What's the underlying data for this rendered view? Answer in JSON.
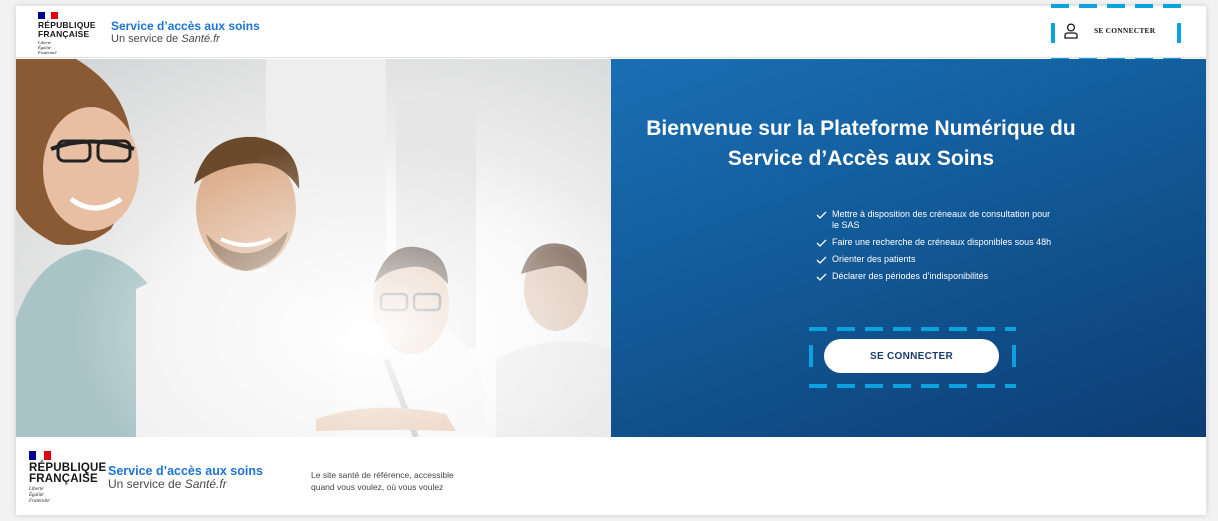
{
  "header": {
    "republique_line1": "RÉPUBLIQUE",
    "republique_line2": "FRANÇAISE",
    "motto": [
      "Liberté",
      "Égalité",
      "Fraternité"
    ],
    "site_title": "Service d’accès aux soins",
    "site_subtitle_prefix": "Un service de ",
    "site_subtitle_brand": "Santé.fr",
    "login_label": "SE CONNECTER",
    "login_icon": "user-icon"
  },
  "hero": {
    "title": "Bienvenue sur la Plateforme Numérique du Service d’Accès aux Soins",
    "features": [
      "Mettre à disposition des créneaux de consultation pour le SAS",
      "Faire une recherche de créneaux disponibles sous 48h",
      "Orienter des patients",
      "Déclarer des périodes d’indisponibilités"
    ],
    "cta_label": "SE CONNECTER"
  },
  "footer": {
    "republique_line1": "RÉPUBLIQUE",
    "republique_line2": "FRANÇAISE",
    "motto": [
      "Liberté",
      "Égalité",
      "Fraternité"
    ],
    "site_title": "Service d’accès aux soins",
    "site_subtitle_prefix": "Un service de ",
    "site_subtitle_brand": "Santé.fr",
    "tagline_line1": "Le site santé de référence, accessible",
    "tagline_line2": "quand vous voulez, où vous voulez"
  },
  "colors": {
    "brand_blue": "#1c74d4",
    "hero_blue": "#125a98",
    "highlight_dash": "#0aa3e0",
    "flag_blue": "#000091",
    "flag_red": "#e1000f"
  }
}
